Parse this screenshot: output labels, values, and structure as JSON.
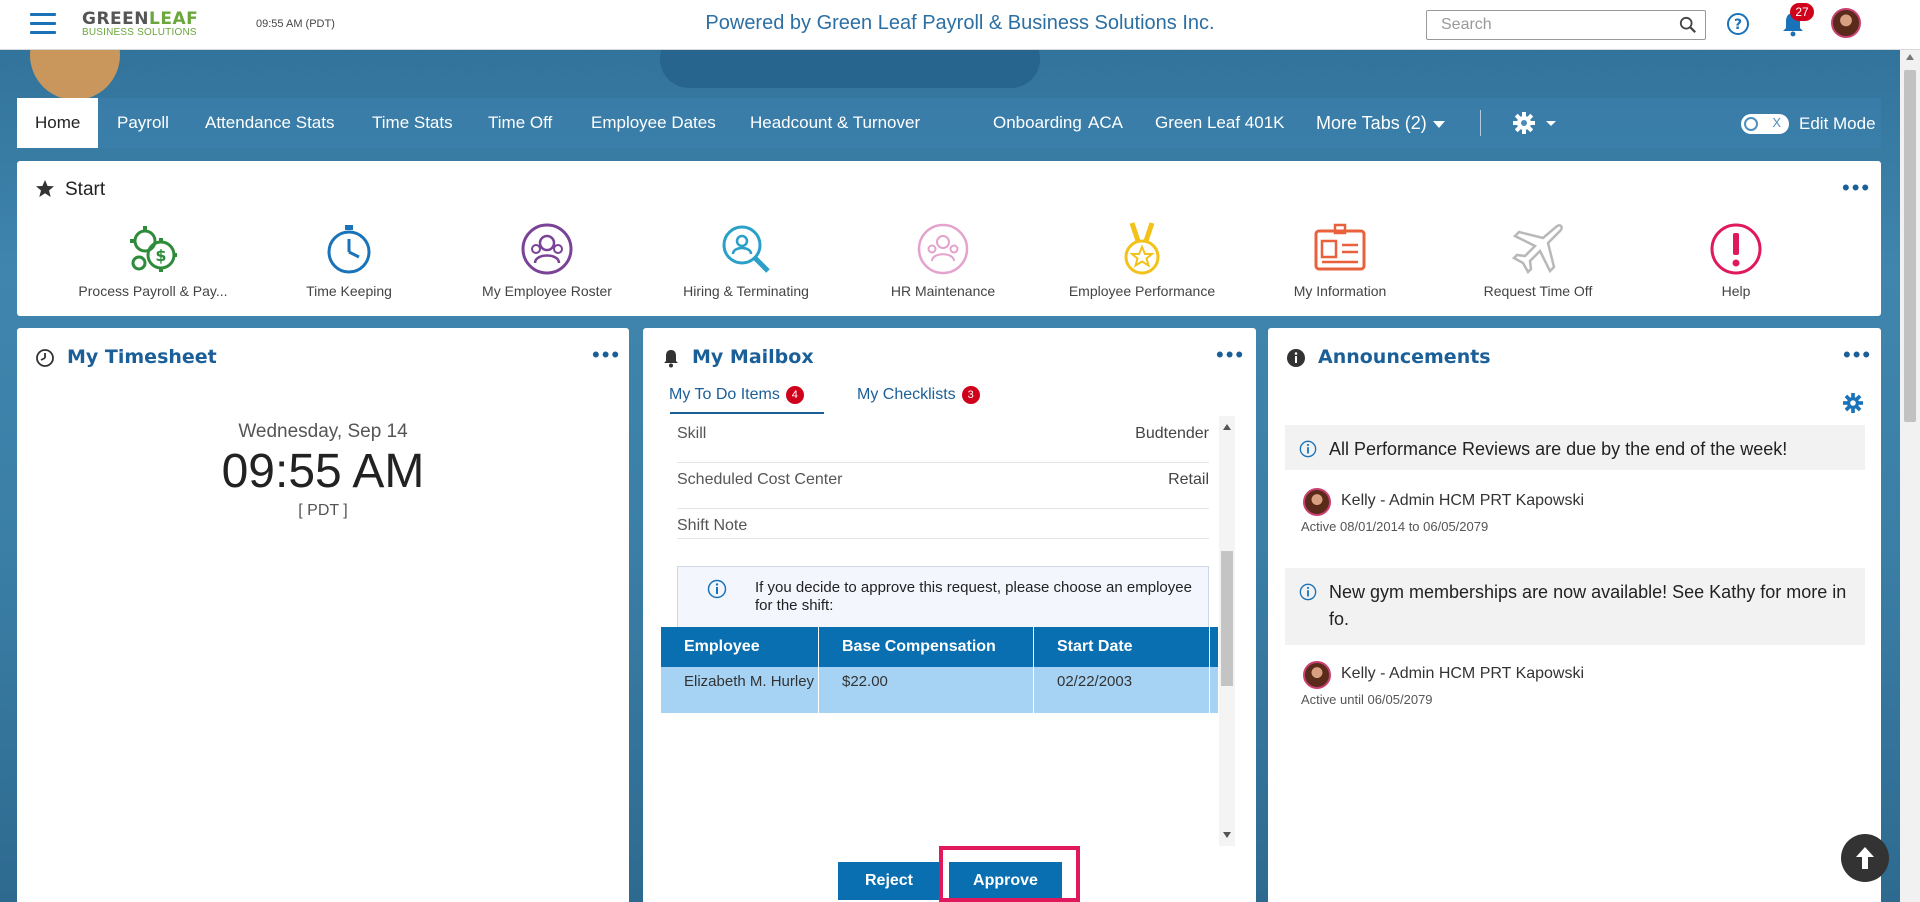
{
  "header": {
    "logo_top_a": "GREEN",
    "logo_top_b": "LEAF",
    "logo_bottom": "BUSINESS SOLUTIONS",
    "time": "09:55 AM (PDT)",
    "powered_by": "Powered by Green Leaf Payroll & Business Solutions Inc.",
    "search_placeholder": "Search",
    "notification_count": "27"
  },
  "tabs": {
    "items": [
      "Home",
      "Payroll",
      "Attendance Stats",
      "Time Stats",
      "Time Off",
      "Employee Dates",
      "Headcount & Turnover",
      "Onboarding",
      "ACA",
      "Green Leaf 401K"
    ],
    "more_tabs": "More Tabs (2)",
    "edit_mode": "Edit Mode",
    "toggle_x": "X"
  },
  "start": {
    "title": "Start",
    "shortcuts": [
      "Process Payroll & Pay...",
      "Time Keeping",
      "My Employee Roster",
      "Hiring & Terminating",
      "HR Maintenance",
      "Employee Performance",
      "My Information",
      "Request Time Off",
      "Help"
    ]
  },
  "timesheet": {
    "title": "My Timesheet",
    "date": "Wednesday, Sep 14",
    "time": "09:55 AM",
    "zone": "[ PDT ]"
  },
  "mailbox": {
    "title": "My Mailbox",
    "tab_todo": "My To Do Items",
    "tab_todo_count": "4",
    "tab_checklists": "My Checklists",
    "tab_checklists_count": "3",
    "rows": [
      {
        "key": "Skill",
        "value": "Budtender"
      },
      {
        "key": "Scheduled Cost Center",
        "value": "Retail"
      },
      {
        "key": "Shift Note",
        "value": ""
      }
    ],
    "info_text": "If you decide to approve this request, please choose an employee for the shift:",
    "table": {
      "headers": [
        "Employee",
        "Base Compensation",
        "Start Date"
      ],
      "row": [
        "Elizabeth M. Hurley",
        "$22.00",
        "02/22/2003"
      ]
    },
    "reject_label": "Reject",
    "approve_label": "Approve"
  },
  "announcements": {
    "title": "Announcements",
    "items": [
      {
        "text": "All Performance Reviews are due by the end of the week!",
        "author": "Kelly - Admin HCM PRT Kapowski",
        "dates": "Active 08/01/2014 to 06/05/2079"
      },
      {
        "text": "New gym memberships are now available! See Kathy for more info.",
        "author": "Kelly - Admin HCM PRT Kapowski",
        "dates": "Active until 06/05/2079"
      }
    ]
  },
  "colors": {
    "brand_blue": "#1b5f99",
    "button_blue": "#0a6fb0",
    "badge_red": "#d0021b",
    "highlight": "#e0185c"
  }
}
